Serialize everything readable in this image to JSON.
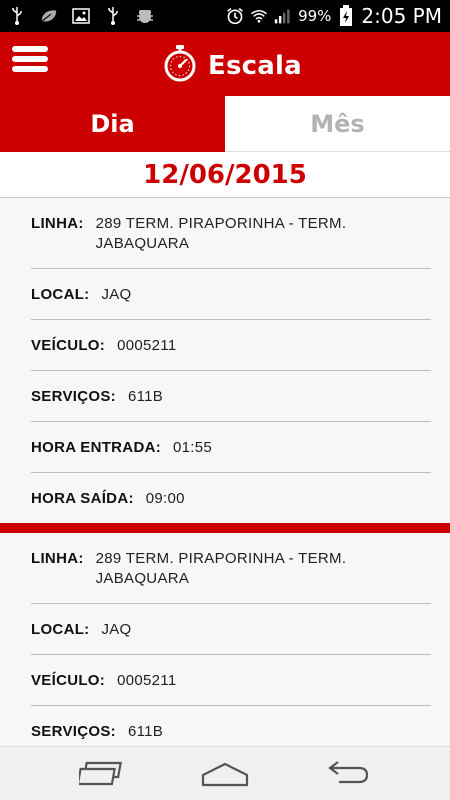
{
  "status_bar": {
    "battery": "99%",
    "time": "2:05 PM",
    "icons": [
      "usb-icon",
      "leaf-icon",
      "image-icon",
      "usb-icon",
      "android-debug-icon",
      "alarm-icon",
      "wifi-icon",
      "signal-icon",
      "battery-icon"
    ]
  },
  "header": {
    "title": "Escala",
    "icon": "stopwatch-icon",
    "accent": "#cc0000"
  },
  "tabs": [
    {
      "label": "Dia",
      "active": true
    },
    {
      "label": "Mês",
      "active": false
    }
  ],
  "date": "12/06/2015",
  "cards": [
    {
      "linha_label": "LINHA:",
      "linha_value": "289 TERM. PIRAPORINHA - TERM. JABAQUARA",
      "local_label": "LOCAL:",
      "local_value": "JAQ",
      "veiculo_label": "VEÍCULO:",
      "veiculo_value": "0005211",
      "servicos_label": "SERVIÇOS:",
      "servicos_value": "611B",
      "entrada_label": "HORA ENTRADA:",
      "entrada_value": "01:55",
      "saida_label": "HORA SAÍDA:",
      "saida_value": "09:00"
    },
    {
      "linha_label": "LINHA:",
      "linha_value": "289 TERM. PIRAPORINHA - TERM. JABAQUARA",
      "local_label": "LOCAL:",
      "local_value": "JAQ",
      "veiculo_label": "VEÍCULO:",
      "veiculo_value": "0005211",
      "servicos_label": "SERVIÇOS:",
      "servicos_value": "611B"
    }
  ],
  "navbar": {
    "icons": [
      "recent-apps-icon",
      "home-icon",
      "back-icon"
    ]
  }
}
